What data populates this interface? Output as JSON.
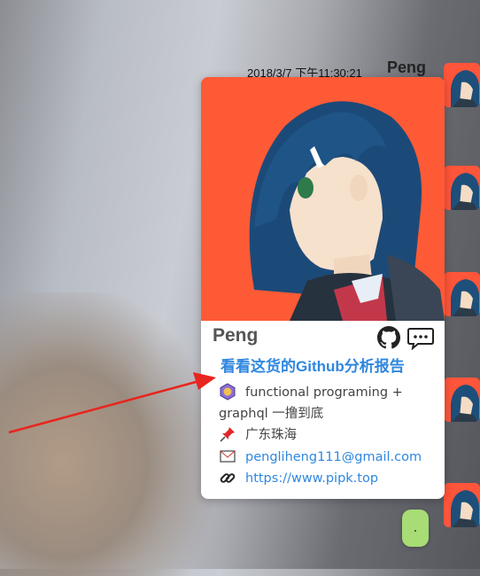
{
  "chat": {
    "timestamp": "2018/3/7 下午11:30:21",
    "sender": "Peng"
  },
  "profile_card": {
    "name": "Peng",
    "report_link": "看看这货的Github分析报告",
    "bio_line1": "functional programing +",
    "bio_line2": "graphql 一撸到底",
    "location": "广东珠海",
    "email": "pengliheng111@gmail.com",
    "website": "https://www.pipk.top",
    "icons": [
      "github-icon",
      "chat-icon",
      "hexagon-badge-icon",
      "pushpin-icon",
      "envelope-icon",
      "link-icon"
    ]
  },
  "floating_button": {
    "label": "."
  },
  "colors": {
    "avatar_bg": "#ff5a36",
    "link_blue": "#2f87e0",
    "button_green": "#a7dd74",
    "arrow_red": "#e8251e"
  }
}
